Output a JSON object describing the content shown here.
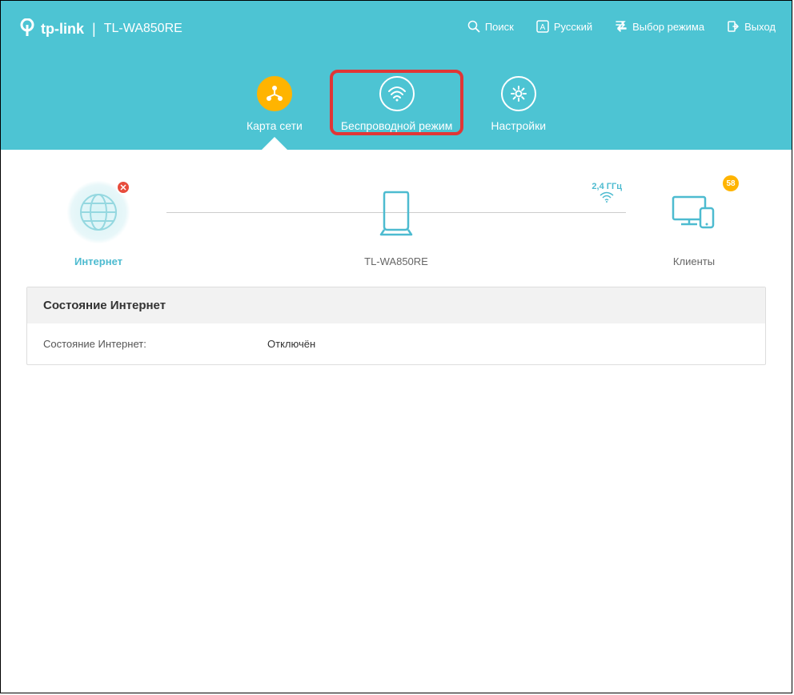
{
  "brand": {
    "name": "tp-link",
    "model": "TL-WA850RE"
  },
  "topActions": {
    "search": "Поиск",
    "language": "Русский",
    "mode": "Выбор режима",
    "logout": "Выход"
  },
  "nav": {
    "map": "Карта сети",
    "wireless": "Беспроводной режим",
    "settings": "Настройки"
  },
  "topology": {
    "internet": "Интернет",
    "device": "TL-WA850RE",
    "clients": "Клиенты",
    "ghz": "2,4 ГГц",
    "clientCount": "58"
  },
  "status": {
    "header": "Состояние Интернет",
    "label": "Состояние Интернет:",
    "value": "Отключён"
  }
}
